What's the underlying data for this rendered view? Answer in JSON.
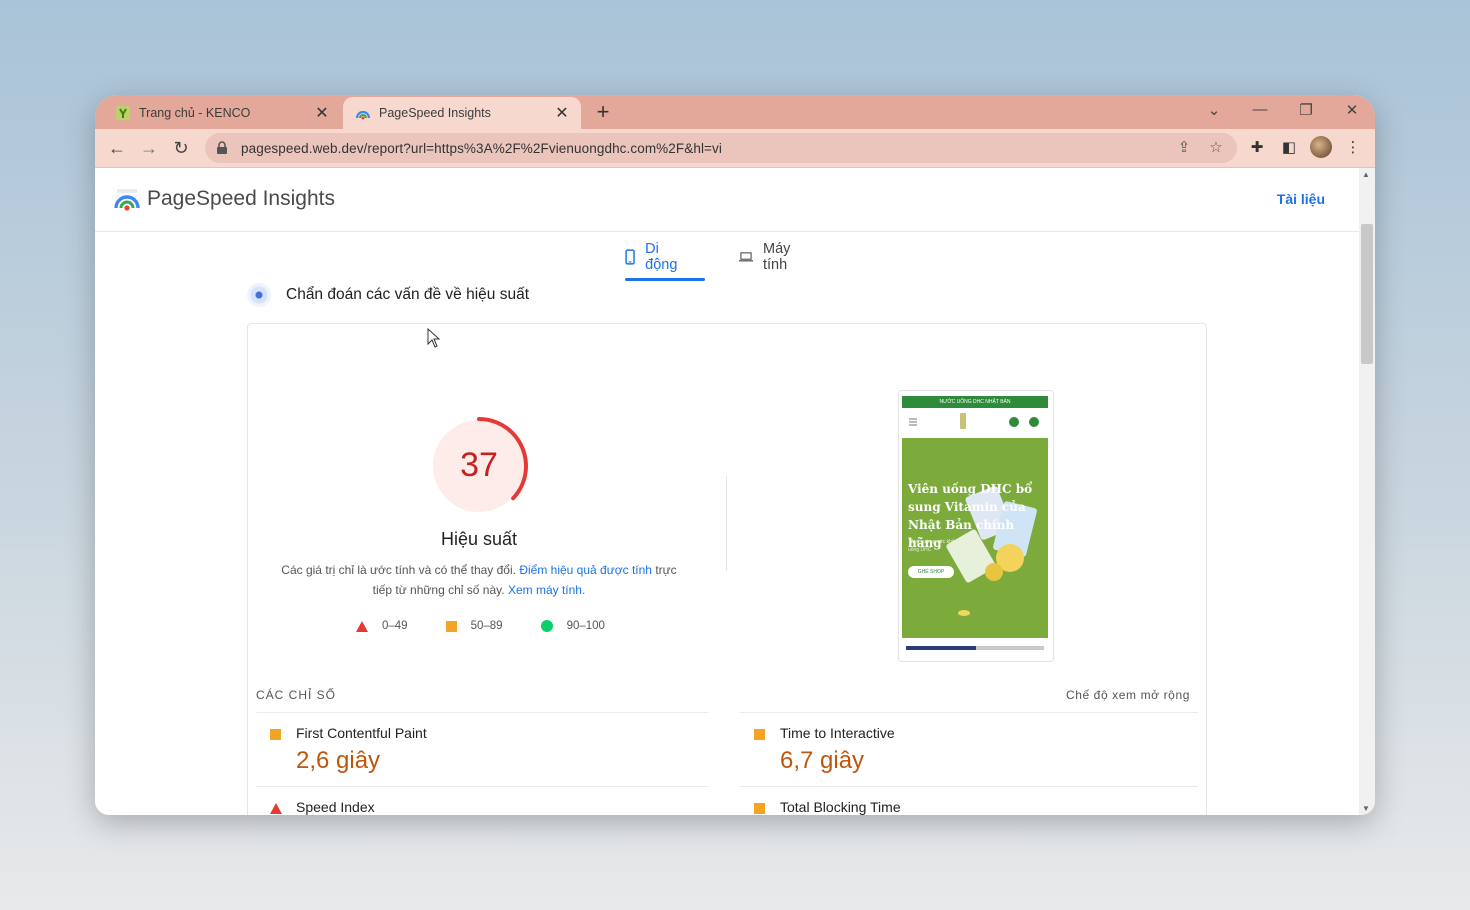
{
  "browser": {
    "tabs": [
      {
        "title": "Trang chủ - KENCO",
        "active": false
      },
      {
        "title": "PageSpeed Insights",
        "active": true
      }
    ],
    "url": "pagespeed.web.dev/report?url=https%3A%2F%2Fvienuongdhc.com%2F&hl=vi"
  },
  "psi": {
    "title": "PageSpeed Insights",
    "docs_link": "Tài liệu",
    "device_tabs": [
      {
        "label": "Di động",
        "active": true
      },
      {
        "label": "Máy tính",
        "active": false
      }
    ],
    "diagnose_title": "Chẩn đoán các vấn đề về hiệu suất",
    "score": 37,
    "score_label": "Hiệu suất",
    "score_desc_1": "Các giá trị chỉ là ước tính và có thể thay đổi.",
    "score_desc_link1": "Điểm hiệu quả được tính",
    "score_desc_2": "trực tiếp từ những chỉ số này.",
    "score_desc_link2": "Xem máy tính.",
    "legend": [
      {
        "range": "0–49",
        "shape": "triangle",
        "color": "#e53935"
      },
      {
        "range": "50–89",
        "shape": "square",
        "color": "#f4a425"
      },
      {
        "range": "90–100",
        "shape": "circle",
        "color": "#0cce6b"
      }
    ],
    "preview": {
      "top_bar": "NƯỚC UỐNG DHC NHẬT BẢN",
      "hero_text": "Viên uống DHC bổ sung Vitamin của Nhật Bản chính hãng",
      "hero_small": "Tăng cường sức khỏe uống DHC",
      "hero_button": "GHÉ SHOP"
    },
    "metrics_heading": "CÁC CHỈ SỐ",
    "expand_label": "Chế độ xem mở rộng",
    "metrics": [
      {
        "name": "First Contentful Paint",
        "value": "2,6 giây",
        "rating": "average"
      },
      {
        "name": "Time to Interactive",
        "value": "6,7 giây",
        "rating": "average"
      },
      {
        "name": "Speed Index",
        "value": "",
        "rating": "poor"
      },
      {
        "name": "Total Blocking Time",
        "value": "",
        "rating": "average"
      }
    ],
    "colors": {
      "accent": "#1a73e8",
      "poor": "#c5221f",
      "average_value": "#c0560b"
    }
  }
}
